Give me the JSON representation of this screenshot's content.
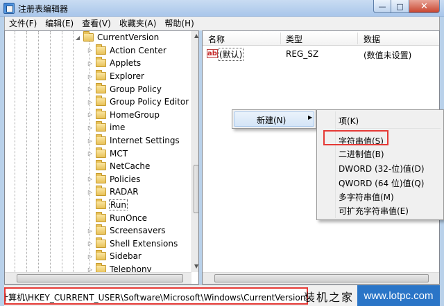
{
  "window": {
    "title": "注册表编辑器",
    "min_glyph": "—",
    "max_glyph": "□",
    "close_glyph": "✕"
  },
  "menu": [
    "文件(F)",
    "编辑(E)",
    "查看(V)",
    "收藏夹(A)",
    "帮助(H)"
  ],
  "tree": {
    "parent": "CurrentVersion",
    "children": [
      {
        "label": "Action Center",
        "expandable": true
      },
      {
        "label": "Applets",
        "expandable": true
      },
      {
        "label": "Explorer",
        "expandable": true
      },
      {
        "label": "Group Policy",
        "expandable": true
      },
      {
        "label": "Group Policy Editor",
        "expandable": true
      },
      {
        "label": "HomeGroup",
        "expandable": true
      },
      {
        "label": "ime",
        "expandable": true
      },
      {
        "label": "Internet Settings",
        "expandable": true
      },
      {
        "label": "MCT",
        "expandable": true
      },
      {
        "label": "NetCache",
        "expandable": false
      },
      {
        "label": "Policies",
        "expandable": true
      },
      {
        "label": "RADAR",
        "expandable": true
      },
      {
        "label": "Run",
        "expandable": false,
        "selected": true
      },
      {
        "label": "RunOnce",
        "expandable": false
      },
      {
        "label": "Screensavers",
        "expandable": true
      },
      {
        "label": "Shell Extensions",
        "expandable": true
      },
      {
        "label": "Sidebar",
        "expandable": true
      },
      {
        "label": "Telephony",
        "expandable": true
      }
    ]
  },
  "list": {
    "columns": {
      "name": "名称",
      "type": "类型",
      "data": "数据"
    },
    "rows": [
      {
        "icon": "ab",
        "name": "(默认)",
        "type": "REG_SZ",
        "data": "(数值未设置)"
      }
    ]
  },
  "context_menu": {
    "new_label": "新建(N)"
  },
  "submenu": {
    "items": [
      "项(K)",
      "字符串值(S)",
      "二进制值(B)",
      "DWORD (32-位)值(D)",
      "QWORD (64 位)值(Q)",
      "多字符串值(M)",
      "可扩充字符串值(E)"
    ],
    "highlighted": "字符串值(S)"
  },
  "status": {
    "path": "计算机\\HKEY_CURRENT_USER\\Software\\Microsoft\\Windows\\CurrentVersion\\Run"
  },
  "watermark": {
    "logo": "装机之家",
    "url": "www.lotpc.com"
  },
  "colors": {
    "highlight_border": "#e53935",
    "watermark_bg": "#2a75c7"
  }
}
